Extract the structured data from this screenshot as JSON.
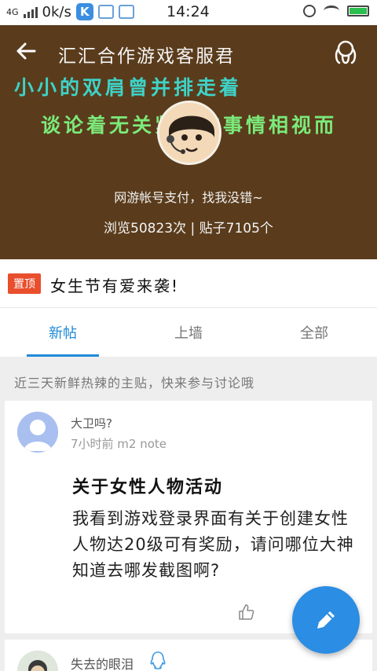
{
  "status_bar": {
    "network": "4G",
    "speed": "0k/s",
    "app_badge": "K",
    "time": "14:24",
    "battery_level": 1.0
  },
  "header": {
    "title": "汇汇合作游戏客服君",
    "slogan_line1": "小小的双肩曾并排走着",
    "slogan_line2": "谈论着无关紧要的事情相视而",
    "description": "网游帐号支付，找我没错~",
    "stats": "浏览50823次 | 贴子7105个",
    "bg_color": "#5a3c1c"
  },
  "pinned": {
    "badge": "置顶",
    "title": "女生节有爱来袭!"
  },
  "tabs": [
    {
      "label": "新帖",
      "active": true
    },
    {
      "label": "上墙",
      "active": false
    },
    {
      "label": "全部",
      "active": false
    }
  ],
  "hint": "近三天新鲜热辣的主贴，快来参与讨论哦",
  "posts": [
    {
      "user": "大卫吗?",
      "meta": "7小时前    m2 note",
      "title": "关于女性人物活动",
      "body": "我看到游戏登录界面有关于创建女性人物达20级可有奖励，请问哪位大神知道去哪发截图啊?"
    },
    {
      "user": "失去的眼泪"
    }
  ],
  "icons": [
    "back-arrow-icon",
    "customer-service-icon",
    "like-icon",
    "edit-icon",
    "qq-icon"
  ],
  "accent_color": "#1f8ad6"
}
